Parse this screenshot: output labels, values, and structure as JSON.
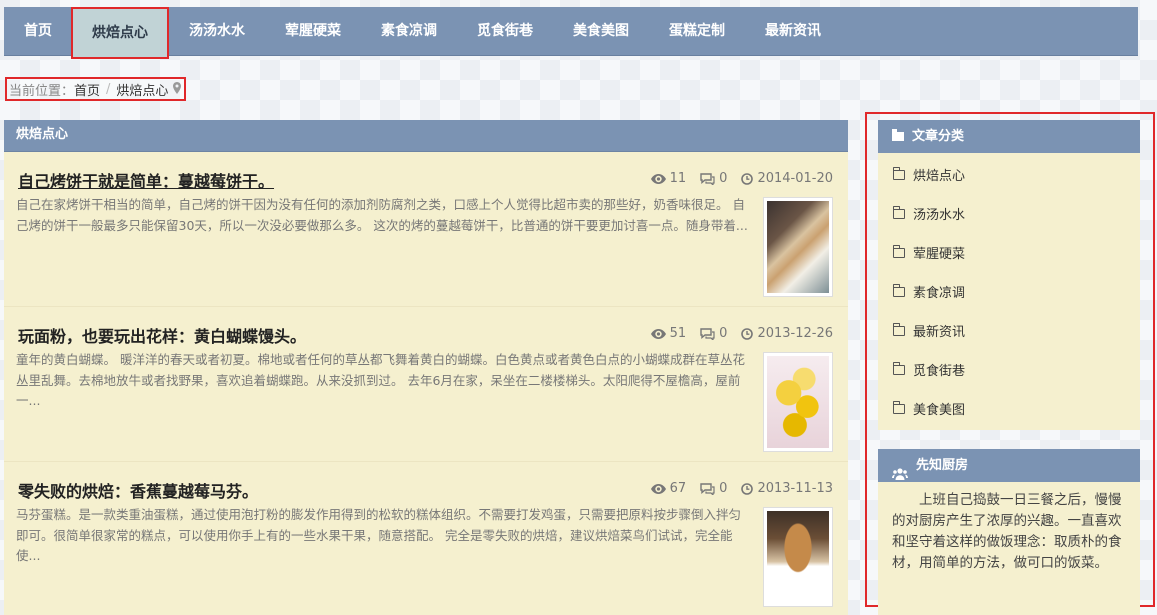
{
  "nav": {
    "items": [
      "首页",
      "烘焙点心",
      "汤汤水水",
      "荤腥硬菜",
      "素食凉调",
      "觅食街巷",
      "美食美图",
      "蛋糕定制",
      "最新资讯"
    ],
    "active_index": 1
  },
  "breadcrumb": {
    "prefix": "当前位置：",
    "home": "首页",
    "separator": "/",
    "current": "烘焙点心",
    "icon": "map-marker-icon"
  },
  "main": {
    "heading": "烘焙点心",
    "articles": [
      {
        "title": "自己烤饼干就是简单：蔓越莓饼干。",
        "views": "11",
        "comments": "0",
        "date": "2014-01-20",
        "summary": "自己在家烤饼干相当的简单，自己烤的饼干因为没有任何的添加剂防腐剂之类，口感上个人觉得比超市卖的那些好，奶香味很足。 自己烤的饼干一般最多只能保留30天，所以一次没必要做那么多。 这次的烤的蔓越莓饼干，比普通的饼干要更加讨喜一点。随身带着...",
        "thumb": "cookie-photo"
      },
      {
        "title": "玩面粉，也要玩出花样：黄白蝴蝶馒头。",
        "views": "51",
        "comments": "0",
        "date": "2013-12-26",
        "summary": "童年的黄白蝴蝶。 暖洋洋的春天或者初夏。棉地或者任何的草丛都飞舞着黄白的蝴蝶。白色黄点或者黄色白点的小蝴蝶成群在草丛花丛里乱舞。去棉地放牛或者找野果，喜欢追着蝴蝶跑。从来没抓到过。 去年6月在家，呆坐在二楼楼梯头。太阳爬得不屋檐高，屋前一...",
        "thumb": "butterfly-bun-photo"
      },
      {
        "title": "零失败的烘焙：香蕉蔓越莓马芬。",
        "views": "67",
        "comments": "0",
        "date": "2013-11-13",
        "summary": "马芬蛋糕。是一款类重油蛋糕，通过使用泡打粉的膨发作用得到的松软的糕体组织。不需要打发鸡蛋，只需要把原料按步骤倒入拌匀即可。很简单很家常的糕点，可以使用你手上有的一些水果干果，随意搭配。 完全是零失败的烘焙，建议烘焙菜鸟们试试，完全能使...",
        "thumb": "muffin-photo"
      }
    ]
  },
  "sidebar": {
    "categories_title": "文章分类",
    "categories": [
      "烘焙点心",
      "汤汤水水",
      "荤腥硬菜",
      "素食凉调",
      "最新资讯",
      "觅食街巷",
      "美食美图"
    ],
    "about_title": "先知厨房",
    "about_text": "上班自己捣鼓一日三餐之后，慢慢的对厨房产生了浓厚的兴趣。一直喜欢和坚守着这样的做饭理念：取质朴的食材，用简单的方法，做可口的饭菜。"
  },
  "colors": {
    "nav_bg": "#7b93b3",
    "active_tab_bg": "#c1d3d6",
    "panel_bg": "#f5f0cf",
    "highlight_border": "#e0282a"
  }
}
